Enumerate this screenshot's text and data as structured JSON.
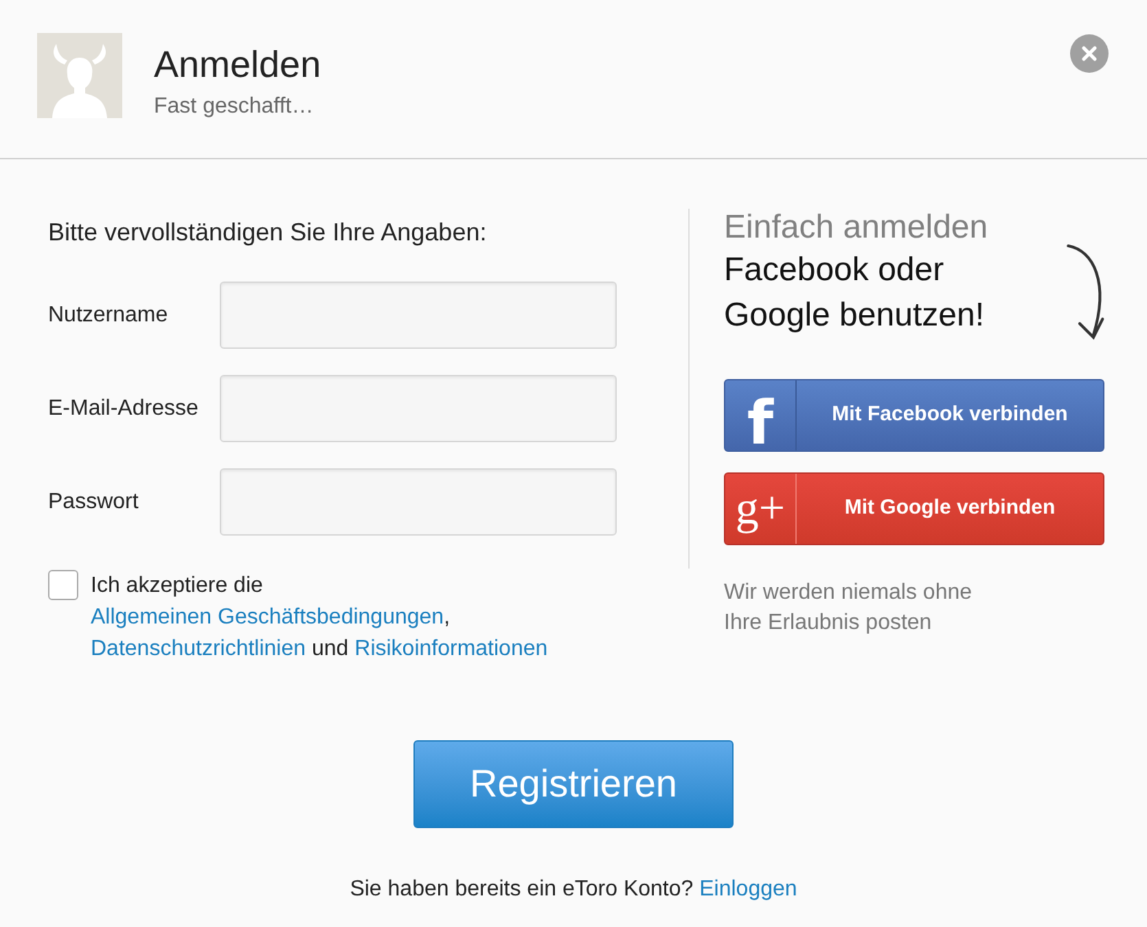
{
  "dialog": {
    "title": "Anmelden",
    "subtitle": "Fast geschafft…"
  },
  "form": {
    "heading": "Bitte vervollständigen Sie Ihre Angaben:",
    "fields": [
      {
        "label": "Nutzername"
      },
      {
        "label": "E-Mail-Adresse"
      },
      {
        "label": "Passwort"
      }
    ],
    "consent": {
      "checked": false,
      "parts": [
        {
          "kind": "text",
          "text": "Ich akzeptiere die"
        },
        {
          "kind": "link",
          "text": "Allgemeinen Geschäftsbedingungen"
        },
        {
          "kind": "text",
          "text": ","
        },
        {
          "kind": "link",
          "text": "Datenschutzrichtlinien"
        },
        {
          "kind": "text",
          "text": "und"
        },
        {
          "kind": "link",
          "text": "Risikoinformationen"
        }
      ]
    }
  },
  "social": {
    "heading": "Einfach anmelden",
    "subheading": "Facebook oder Google benutzen!",
    "buttons": [
      {
        "kind": "facebook",
        "glyph": "f",
        "label": "Mit Facebook verbinden"
      },
      {
        "kind": "google",
        "glyph": "g+",
        "label": "Mit Google verbinden"
      }
    ],
    "note": "Wir werden niemals ohne Ihre Erlaubnis posten"
  },
  "submit": "Registrieren",
  "footer": {
    "text": "Sie haben bereits ein eToro Konto?",
    "link": "Einloggen"
  }
}
